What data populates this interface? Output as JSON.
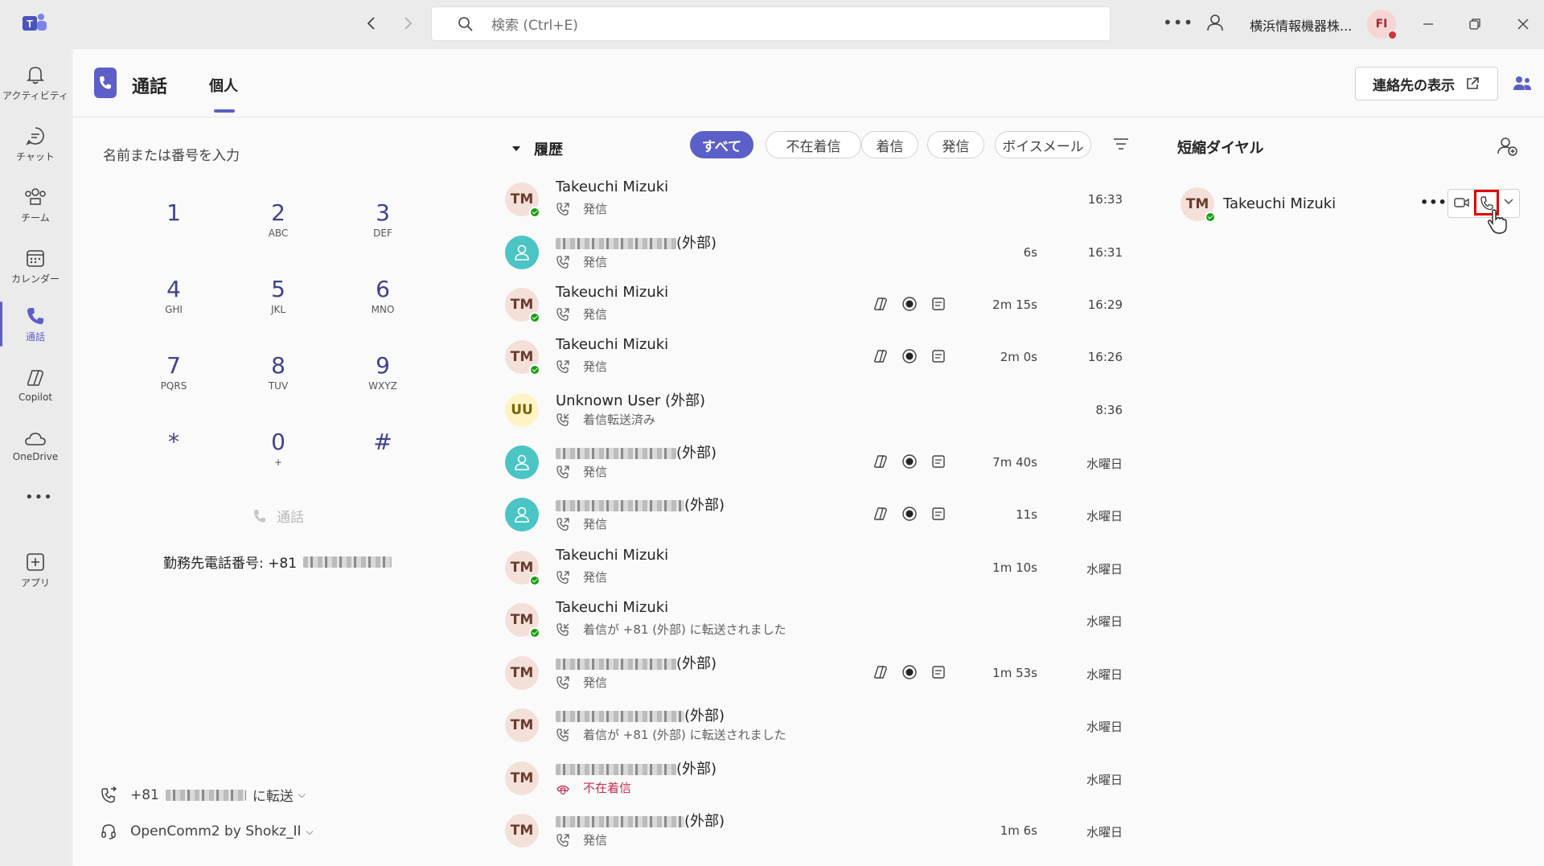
{
  "titlebar": {
    "search_placeholder": "検索 (Ctrl+E)",
    "org_name": "横浜情報機器株...",
    "user_initials": "FI"
  },
  "rail": {
    "items": [
      {
        "label": "アクティビティ"
      },
      {
        "label": "チャット"
      },
      {
        "label": "チーム"
      },
      {
        "label": "カレンダー"
      },
      {
        "label": "通話"
      },
      {
        "label": "Copilot"
      },
      {
        "label": "OneDrive"
      },
      {
        "label": "アプリ"
      }
    ]
  },
  "header": {
    "title": "通話",
    "tab_personal": "個人",
    "show_contacts": "連絡先の表示"
  },
  "dialpad": {
    "placeholder": "名前または番号を入力",
    "keys": [
      {
        "num": "1",
        "sub": ""
      },
      {
        "num": "2",
        "sub": "ABC"
      },
      {
        "num": "3",
        "sub": "DEF"
      },
      {
        "num": "4",
        "sub": "GHI"
      },
      {
        "num": "5",
        "sub": "JKL"
      },
      {
        "num": "6",
        "sub": "MNO"
      },
      {
        "num": "7",
        "sub": "PQRS"
      },
      {
        "num": "8",
        "sub": "TUV"
      },
      {
        "num": "9",
        "sub": "WXYZ"
      },
      {
        "num": "*",
        "sub": ""
      },
      {
        "num": "0",
        "sub": "+"
      },
      {
        "num": "#",
        "sub": ""
      }
    ],
    "call_label": "通話",
    "work_number_label": "勤務先電話番号: +81",
    "forward_prefix": "+81",
    "forward_label": "に転送",
    "device_label": "OpenComm2 by Shokz_II"
  },
  "history": {
    "title": "履歴",
    "filters": [
      "すべて",
      "不在着信",
      "着信",
      "発信",
      "ボイスメール"
    ],
    "rows": [
      {
        "initials": "TM",
        "avatar": "tm",
        "presence": true,
        "name": "Takeuchi Mizuki",
        "blur": false,
        "suffix": "",
        "sub": "発信",
        "sub_type": "out",
        "icons": false,
        "duration": "",
        "time": "16:33"
      },
      {
        "initials": "",
        "avatar": "teal",
        "presence": false,
        "name": "",
        "blur": true,
        "suffix": "(外部)",
        "sub": "発信",
        "sub_type": "out",
        "icons": false,
        "duration": "6s",
        "time": "16:31"
      },
      {
        "initials": "TM",
        "avatar": "tm",
        "presence": true,
        "name": "Takeuchi Mizuki",
        "blur": false,
        "suffix": "",
        "sub": "発信",
        "sub_type": "out",
        "icons": true,
        "duration": "2m 15s",
        "time": "16:29"
      },
      {
        "initials": "TM",
        "avatar": "tm",
        "presence": true,
        "name": "Takeuchi Mizuki",
        "blur": false,
        "suffix": "",
        "sub": "発信",
        "sub_type": "out",
        "icons": true,
        "duration": "2m 0s",
        "time": "16:26"
      },
      {
        "initials": "UU",
        "avatar": "yellow",
        "presence": false,
        "name": "Unknown User (外部)",
        "blur": false,
        "suffix": "",
        "sub": "着信転送済み",
        "sub_type": "fwd",
        "icons": false,
        "duration": "",
        "time": "8:36"
      },
      {
        "initials": "",
        "avatar": "teal",
        "presence": false,
        "name": "",
        "blur": true,
        "suffix": "(外部)",
        "sub": "発信",
        "sub_type": "out",
        "icons": true,
        "duration": "7m 40s",
        "time": "水曜日"
      },
      {
        "initials": "",
        "avatar": "teal",
        "presence": false,
        "name": "",
        "blur": true,
        "suffix": "(外部)",
        "sub": "発信",
        "sub_type": "out",
        "icons": true,
        "duration": "11s",
        "time": "水曜日"
      },
      {
        "initials": "TM",
        "avatar": "tm",
        "presence": true,
        "name": "Takeuchi Mizuki",
        "blur": false,
        "suffix": "",
        "sub": "発信",
        "sub_type": "out",
        "icons": false,
        "duration": "1m 10s",
        "time": "水曜日"
      },
      {
        "initials": "TM",
        "avatar": "tm",
        "presence": true,
        "name": "Takeuchi Mizuki",
        "blur": false,
        "suffix": "",
        "sub": "着信が +81 (外部) に転送されました",
        "sub_type": "fwd",
        "icons": false,
        "duration": "",
        "time": "水曜日"
      },
      {
        "initials": "TM",
        "avatar": "tm",
        "presence": false,
        "name": "",
        "blur": true,
        "suffix": "(外部)",
        "sub": "発信",
        "sub_type": "out",
        "icons": true,
        "duration": "1m 53s",
        "time": "水曜日"
      },
      {
        "initials": "TM",
        "avatar": "tm",
        "presence": false,
        "name": "",
        "blur": true,
        "suffix": "(外部)",
        "sub": "着信が +81 (外部) に転送されました",
        "sub_type": "fwd",
        "icons": false,
        "duration": "",
        "time": "水曜日"
      },
      {
        "initials": "TM",
        "avatar": "tm",
        "presence": false,
        "name": "",
        "blur": true,
        "suffix": "(外部)",
        "sub": "不在着信",
        "sub_type": "missed",
        "icons": false,
        "duration": "",
        "time": "水曜日"
      },
      {
        "initials": "TM",
        "avatar": "tm",
        "presence": false,
        "name": "",
        "blur": true,
        "suffix": "(外部)",
        "sub": "発信",
        "sub_type": "out",
        "icons": false,
        "duration": "1m 6s",
        "time": "水曜日"
      }
    ]
  },
  "speed_dial": {
    "title": "短縮ダイヤル",
    "contact_initials": "TM",
    "contact_name": "Takeuchi Mizuki"
  },
  "colors": {
    "accent": "#5b5fc7",
    "presence": "#13a10e",
    "missed": "#c4314b",
    "highlight": "#e00000"
  }
}
